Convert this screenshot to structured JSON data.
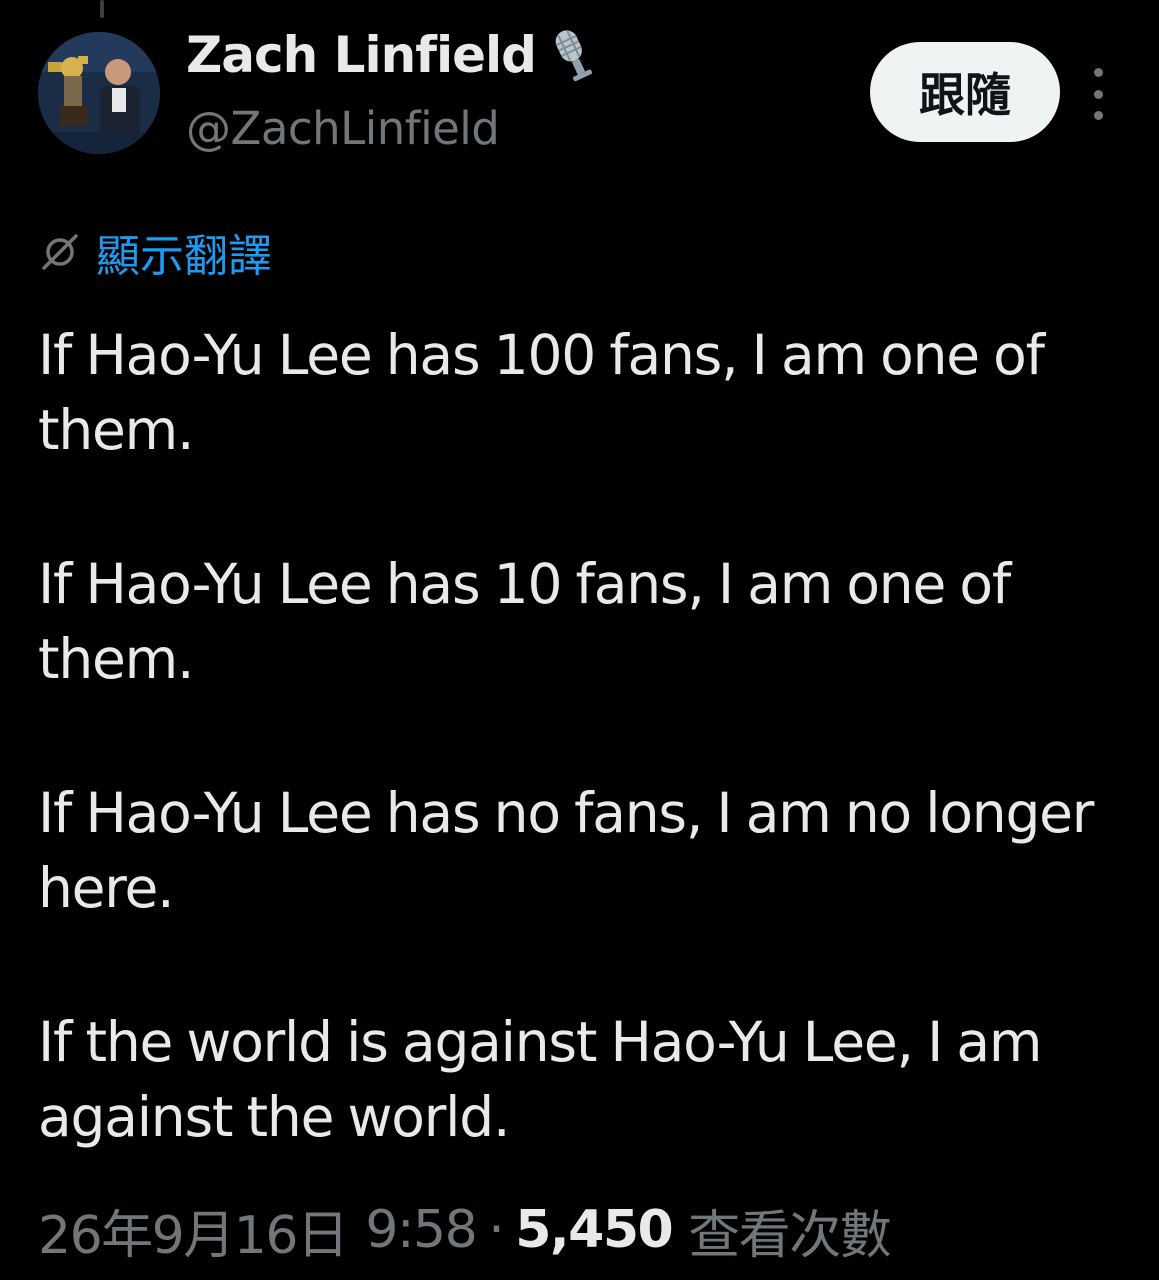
{
  "author": {
    "display_name": "Zach Linfield",
    "handle": "@ZachLinfield",
    "badge_icon": "microphone-icon",
    "avatar_icon": "avatar-photo"
  },
  "actions": {
    "follow_label": "跟隨",
    "more_icon": "more-vertical-icon"
  },
  "translate": {
    "icon": "translate-icon",
    "label": "顯示翻譯"
  },
  "tweet": {
    "paragraphs": [
      "If Hao-Yu Lee has 100 fans, I am one of them.",
      "If Hao-Yu Lee has 10 fans, I am one of them.",
      "If Hao-Yu Lee has no fans, I am no longer here.",
      "If the world is against Hao-Yu Lee, I am against the world."
    ]
  },
  "meta": {
    "date": "26年9月16日",
    "time": "9:58",
    "separator": "·",
    "views_count": "5,450",
    "views_label": "查看次數"
  },
  "colors": {
    "background": "#000000",
    "primary_text": "#e7e9ea",
    "secondary_text": "#71767b",
    "link": "#1d9bf0",
    "follow_button_bg": "#eff3f4",
    "follow_button_text": "#0f1419"
  }
}
